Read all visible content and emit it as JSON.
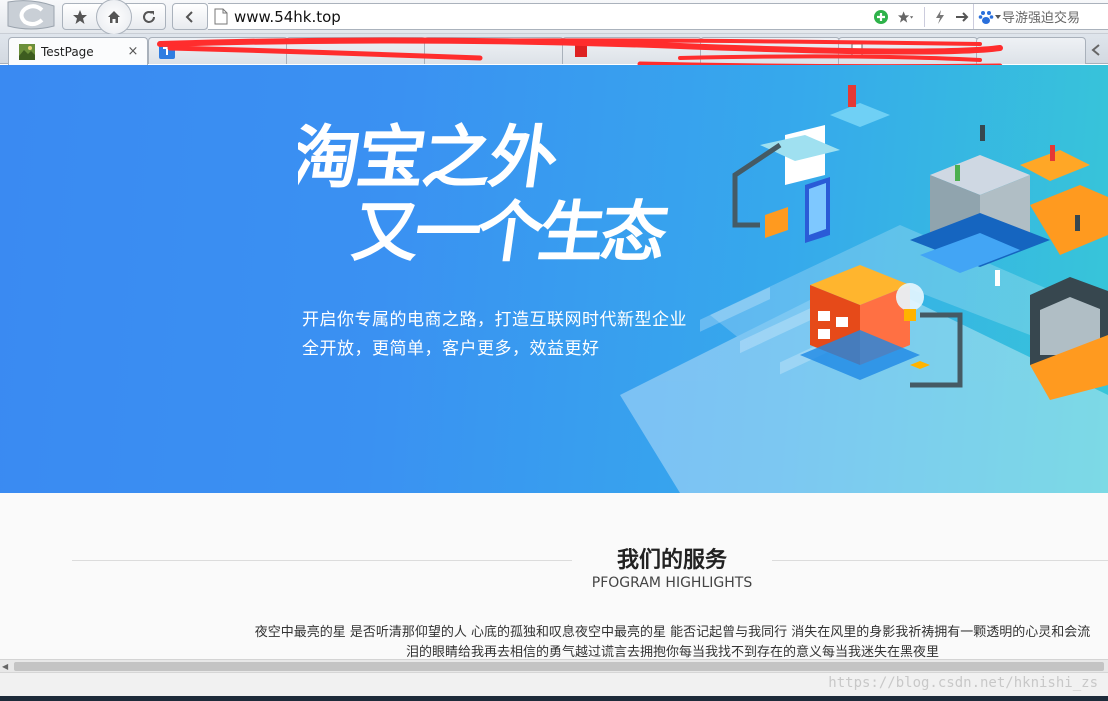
{
  "browser": {
    "url": "www.54hk.top",
    "search_placeholder": "导游强迫交易",
    "tabs": [
      {
        "label": "TestPage",
        "close": "×"
      },
      {
        "label": "",
        "close": ""
      },
      {
        "label": "",
        "close": ""
      },
      {
        "label": "",
        "close": ""
      },
      {
        "label": "",
        "close": ""
      },
      {
        "label": "",
        "close": ""
      },
      {
        "label": "",
        "close": ""
      }
    ]
  },
  "hero": {
    "title_line1": "淘宝之外",
    "title_line2": "又一个生态",
    "subtitle_line1": "开启你专属的电商之路，打造互联网时代新型企业",
    "subtitle_line2": "全开放，更简单，客户更多，效益更好"
  },
  "services": {
    "title": "我们的服务",
    "subtitle": "PFOGRAM HIGHLIGHTS",
    "description": "夜空中最亮的星 是否听清那仰望的人 心底的孤独和叹息夜空中最亮的星 能否记起曾与我同行 消失在风里的身影我祈祷拥有一颗透明的心灵和会流泪的眼睛给我再去相信的勇气越过谎言去拥抱你每当我找不到存在的意义每当我迷失在黑夜里"
  },
  "footer": {
    "watermark": "https://blog.csdn.net/hknishi_zs"
  },
  "colors": {
    "hero_left": "#3a8af2",
    "hero_right": "#37c6d8",
    "redaction": "#ff2d2d"
  }
}
